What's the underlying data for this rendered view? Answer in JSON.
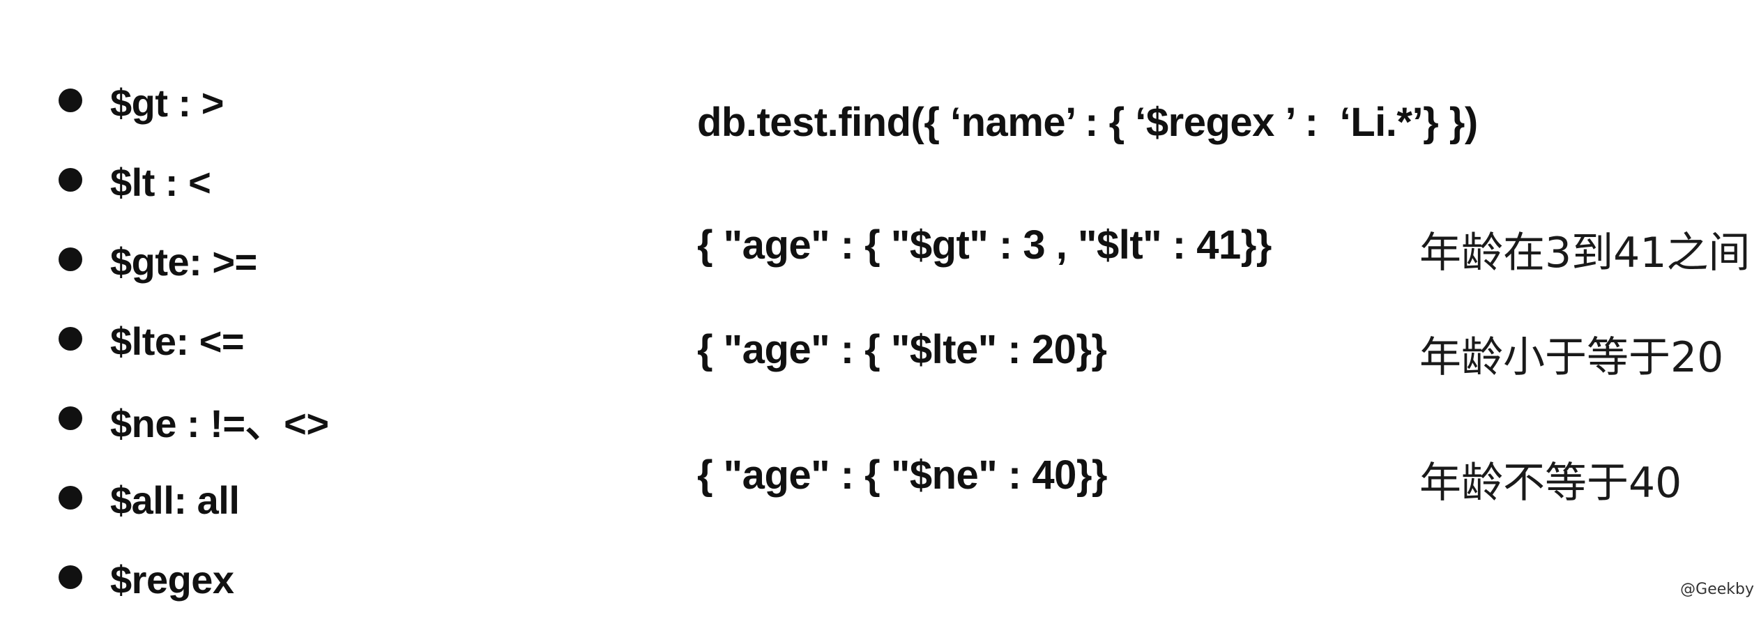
{
  "operators": [
    {
      "label": "$gt : >"
    },
    {
      "label": "$lt : <"
    },
    {
      "label": "$gte: >="
    },
    {
      "label": "$lte: <="
    },
    {
      "label": "$ne : !=、<>"
    },
    {
      "label": "$all: all"
    },
    {
      "label": "$regex"
    }
  ],
  "examples": {
    "regex_query": "db.test.find({ ‘name’ : { ‘$regex ’ :  ‘Li.*’} })",
    "gt_lt_query": "{ \"age\" : { \"$gt\" : 3 , \"$lt\" : 41}}",
    "gt_lt_note": "年龄在3到41之间",
    "lte_query": "{ \"age\" : { \"$lte\" : 20}}",
    "lte_note": "年龄小于等于20",
    "ne_query": "{ \"age\" : { \"$ne\" : 40}}",
    "ne_note": "年龄不等于40"
  },
  "watermark": "@Geekby"
}
